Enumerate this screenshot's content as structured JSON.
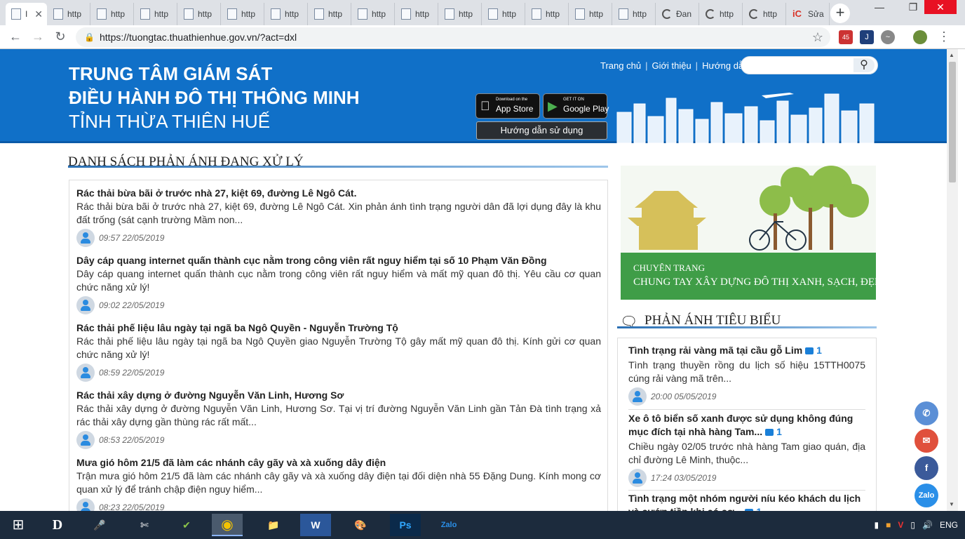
{
  "browser": {
    "tabs": [
      {
        "label": "I",
        "kind": "doc",
        "active": true
      },
      {
        "label": "http",
        "kind": "doc"
      },
      {
        "label": "http",
        "kind": "doc"
      },
      {
        "label": "http",
        "kind": "doc"
      },
      {
        "label": "http",
        "kind": "doc"
      },
      {
        "label": "http",
        "kind": "doc"
      },
      {
        "label": "http",
        "kind": "doc"
      },
      {
        "label": "http",
        "kind": "doc"
      },
      {
        "label": "http",
        "kind": "doc"
      },
      {
        "label": "http",
        "kind": "doc"
      },
      {
        "label": "http",
        "kind": "doc"
      },
      {
        "label": "http",
        "kind": "doc"
      },
      {
        "label": "http",
        "kind": "doc"
      },
      {
        "label": "http",
        "kind": "doc"
      },
      {
        "label": "http",
        "kind": "doc"
      },
      {
        "label": "Đan",
        "kind": "loading"
      },
      {
        "label": "http",
        "kind": "loading"
      },
      {
        "label": "http",
        "kind": "loading"
      },
      {
        "label": "Sửa",
        "kind": "ic"
      }
    ],
    "new_tab_label": "+",
    "url": "https://tuongtac.thuathienhue.gov.vn/?act=dxl",
    "extension_badge": "45"
  },
  "site": {
    "title_line1": "TRUNG TÂM GIÁM SÁT",
    "title_line2": "ĐIỀU HÀNH ĐÔ THỊ THÔNG MINH",
    "title_line3": "TỈNH THỪA THIÊN HUẾ",
    "nav": [
      "Trang chủ",
      "Giới thiệu",
      "Hướng dẫn"
    ],
    "search_placeholder": "",
    "appstore_small": "Download on the",
    "appstore_big": "App Store",
    "googleplay_small": "GET IT ON",
    "googleplay_big": "Google Play",
    "guide_button": "Hướng dẫn sử dụng"
  },
  "main": {
    "heading": "DANH SÁCH PHẢN ÁNH ĐANG XỬ LÝ",
    "items": [
      {
        "title": "Rác thải bừa bãi ở trước nhà 27, kiệt 69, đường Lê Ngô Cát.",
        "desc": "Rác thải bừa bãi ở trước nhà 27, kiệt 69, đường Lê Ngô Cát. Xin phản ánh tình trạng người dân đã lợi dụng đây là khu đất trống (sát cạnh trường Mầm non...",
        "time": "09:57 22/05/2019"
      },
      {
        "title": "Dây cáp quang internet quấn thành cục nằm trong công viên rất nguy hiểm tại số 10 Phạm Văn Đồng",
        "desc": "Dây cáp quang internet quấn thành cục nằm trong công viên rất nguy hiểm và mất mỹ quan đô thị. Yêu cầu cơ quan chức năng xử lý!",
        "time": "09:02 22/05/2019"
      },
      {
        "title": "Rác thải phế liệu lâu ngày tại ngã ba Ngô Quyền - Nguyễn Trường Tộ",
        "desc": "Rác thải phế liệu lâu ngày tại ngã ba Ngô Quyền giao Nguyễn Trường Tộ gây mất mỹ quan đô thị. Kính gửi cơ quan chức năng xử lý!",
        "time": "08:59 22/05/2019"
      },
      {
        "title": "Rác thải xây dựng ở đường Nguyễn Văn Linh, Hương Sơ",
        "desc": "Rác thải xây dựng ở đường Nguyễn Văn Linh, Hương Sơ. Tại vị trí đường Nguyễn Văn Linh gần Tản Đà tình trạng xả rác thải xây dựng gần thùng rác rất mất...",
        "time": "08:53 22/05/2019"
      },
      {
        "title": "Mưa gió hôm 21/5 đã làm các nhánh cây gãy và xà xuống dây điện",
        "desc": "Trận mưa gió hôm 21/5 đã làm các nhánh cây gãy và xà xuống dây điện tại đối diện nhà 55 Đặng Dung. Kính mong cơ quan xử lý để tránh chập điện nguy hiểm...",
        "time": "08:23 22/05/2019"
      }
    ]
  },
  "side": {
    "banner_line1": "CHUYÊN TRANG",
    "banner_line2": "CHUNG TAY XÂY DỰNG ĐÔ THỊ XANH, SẠCH, ĐẸP",
    "heading": "PHẢN ÁNH TIÊU BIỂU",
    "items": [
      {
        "title": "Tình trạng rải vàng mã tại cầu gỗ Lim",
        "count": "1",
        "desc": "Tình trạng thuyền rồng du lịch số hiệu 15TTH0075 cúng rải vàng mã trên...",
        "time": "20:00 05/05/2019"
      },
      {
        "title": "Xe ô tô biển số xanh được sử dụng không đúng mục đích tại nhà hàng Tam...",
        "count": "1",
        "desc": "Chiều ngày 02/05 trước nhà hàng Tam giao quán, địa chỉ đường Lê Minh, thuộc...",
        "time": "17:24 03/05/2019"
      },
      {
        "title": "Tình trạng một nhóm người níu kéo khách du lịch và cướp tiền khi có cơ...",
        "count": "1",
        "desc": "",
        "time": ""
      }
    ]
  },
  "floating": {
    "zalo_label": "Zalo"
  },
  "taskbar": {
    "language": "ENG"
  },
  "colors": {
    "header_blue": "#1070c8",
    "banner_green": "#3f9d47",
    "accent_blue": "#1a7fd8"
  }
}
